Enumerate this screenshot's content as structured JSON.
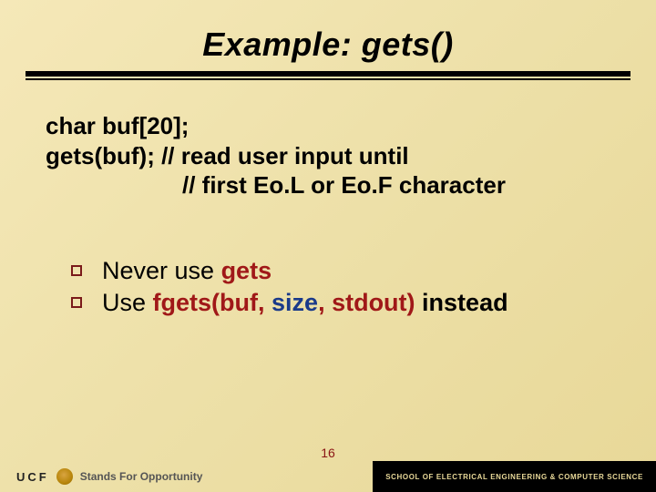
{
  "title": "Example: gets()",
  "code": {
    "line1": "char buf[20];",
    "line2": "gets(buf);  // read user input until",
    "line3": "// first Eo.L or Eo.F character"
  },
  "bullets": [
    {
      "pre": "Never use ",
      "kw": "gets",
      "post": ""
    },
    {
      "pre": "Use ",
      "call_open": "fgets(buf, ",
      "size": "size",
      "call_close": ", stdout)",
      "post": " instead"
    }
  ],
  "slide_number": "16",
  "footer": {
    "ucf": "UCF",
    "tagline": "Stands For Opportunity",
    "right": "SCHOOL OF ELECTRICAL ENGINEERING & COMPUTER SCIENCE"
  }
}
